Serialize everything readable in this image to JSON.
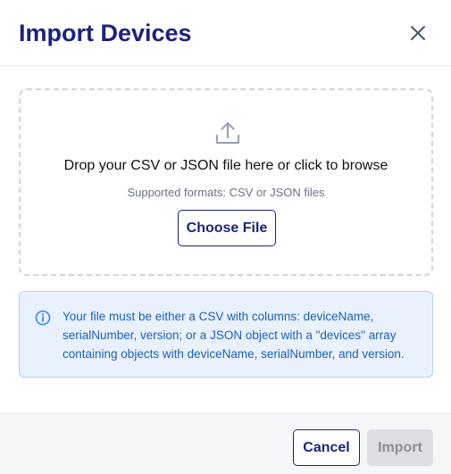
{
  "dialog": {
    "title": "Import Devices",
    "close_icon": "close-icon"
  },
  "dropzone": {
    "icon": "upload-icon",
    "instruction": "Drop your CSV or JSON file here or click to browse",
    "formats": "Supported formats: CSV or JSON files",
    "choose_label": "Choose File"
  },
  "info": {
    "icon": "info-icon",
    "text": "Your file must be either a CSV with columns: deviceName, serialNumber, version; or a JSON object with a \"devices\" array containing objects with deviceName, serialNumber, and version."
  },
  "footer": {
    "cancel_label": "Cancel",
    "import_label": "Import",
    "import_disabled": true
  },
  "colors": {
    "primary": "#1a237e",
    "info_text": "#1d5fb8",
    "info_background": "#e8f1fc",
    "disabled_button": "#dcdee3"
  }
}
